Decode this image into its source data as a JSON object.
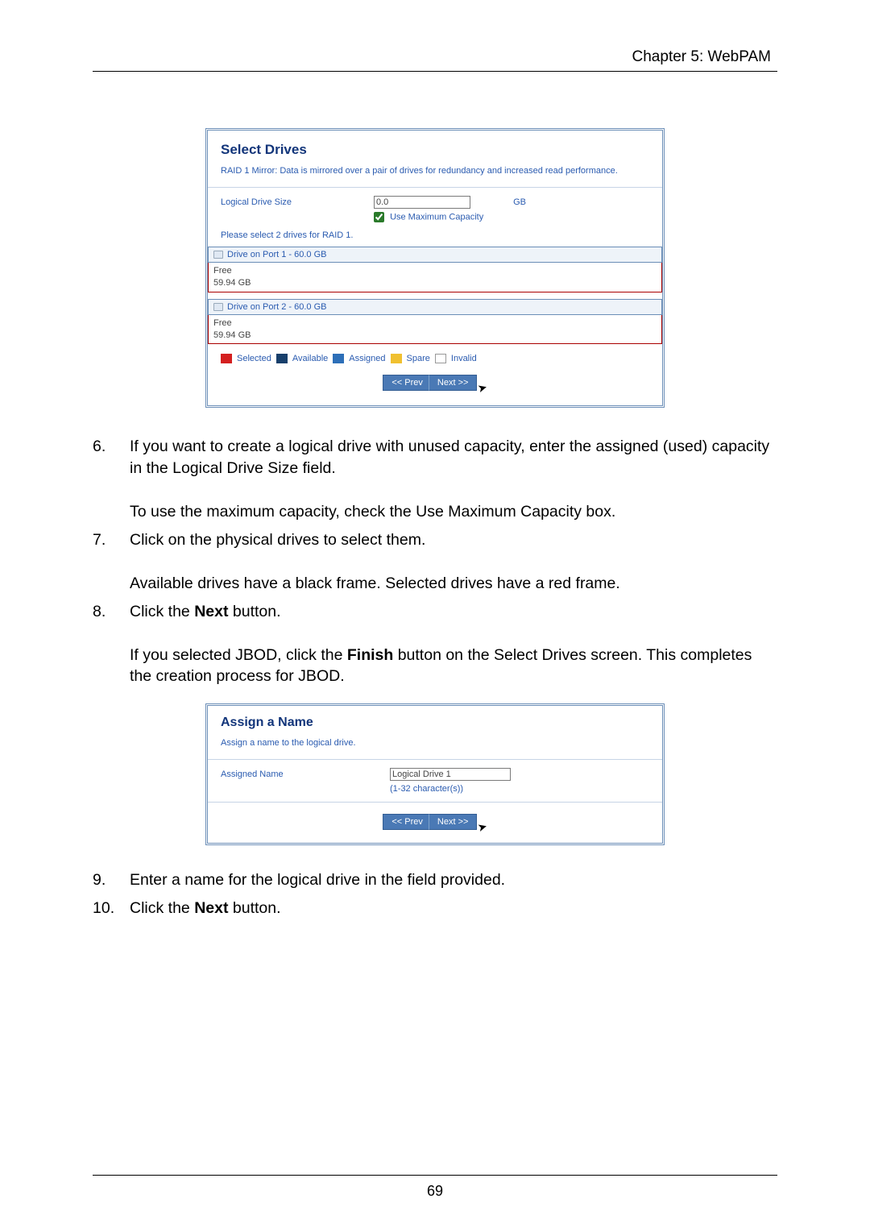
{
  "header": {
    "chapter": "Chapter 5: WebPAM"
  },
  "panel1": {
    "title": "Select Drives",
    "desc": "RAID 1 Mirror: Data is mirrored over a pair of drives for redundancy and increased read performance.",
    "size_label": "Logical Drive Size",
    "size_value": "0.0",
    "size_unit": "GB",
    "use_max_label": "Use Maximum Capacity",
    "select_instr": "Please select 2 drives for RAID 1.",
    "drives": [
      {
        "hdr": "Drive on Port 1 - 60.0 GB",
        "free_label": "Free",
        "free_val": "59.94 GB"
      },
      {
        "hdr": "Drive on Port 2 - 60.0 GB",
        "free_label": "Free",
        "free_val": "59.94 GB"
      }
    ],
    "legend": {
      "selected": "Selected",
      "available": "Available",
      "assigned": "Assigned",
      "spare": "Spare",
      "invalid": "Invalid"
    },
    "prev": "<< Prev",
    "next": "Next >>"
  },
  "steps1": {
    "s6_num": "6.",
    "s6_a": "If you want to create a logical drive with unused capacity, enter the assigned (used) capacity in the Logical Drive Size field.",
    "s6_b": "To use the maximum capacity, check the Use Maximum Capacity box.",
    "s7_num": "7.",
    "s7_a": "Click on the physical drives to select them.",
    "s7_b": "Available drives have a black frame. Selected drives have a red frame.",
    "s8_num": "8.",
    "s8_a_pre": "Click the ",
    "s8_a_bold": "Next",
    "s8_a_post": " button.",
    "s8_b_pre": "If you selected JBOD, click the ",
    "s8_b_bold": "Finish",
    "s8_b_post": " button on the Select Drives screen. This completes the creation process for JBOD."
  },
  "panel2": {
    "title": "Assign a Name",
    "desc": "Assign a name to the logical drive.",
    "name_label": "Assigned Name",
    "name_value": "Logical Drive 1",
    "char_hint": "(1-32 character(s))",
    "prev": "<< Prev",
    "next": "Next >>"
  },
  "steps2": {
    "s9_num": "9.",
    "s9": "Enter a name for the logical drive in the field provided.",
    "s10_num": "10.",
    "s10_pre": "Click the ",
    "s10_bold": "Next",
    "s10_post": " button."
  },
  "footer": {
    "page": "69"
  }
}
